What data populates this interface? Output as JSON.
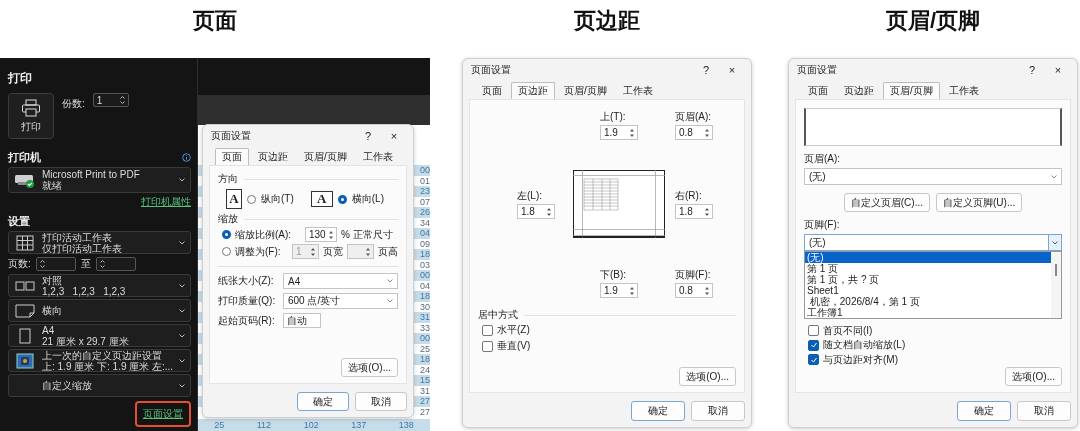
{
  "page_view": {
    "heading": "页面",
    "backstage": {
      "title": "打印",
      "print_button": "打印",
      "copies_label": "份数:",
      "copies_value": "1",
      "printer_heading": "打印机",
      "printer": {
        "name": "Microsoft Print to PDF",
        "status": "就绪"
      },
      "printer_properties": "打印机属性",
      "settings_heading": "设置",
      "settings": [
        {
          "kind": "print_area",
          "lines": [
            "打印活动工作表",
            "仅打印活动工作表"
          ]
        },
        {
          "kind": "page_range",
          "label": "页数:",
          "to": "至"
        },
        {
          "kind": "collation",
          "lines": [
            "对照",
            "1,2,3   1,2,3   1,2,3"
          ]
        },
        {
          "kind": "orientation",
          "lines": [
            "横向"
          ]
        },
        {
          "kind": "paper_size",
          "lines": [
            "A4",
            "21 厘米 x 29.7 厘米"
          ]
        },
        {
          "kind": "margins",
          "lines": [
            "上一次的自定义页边距设置",
            "上: 1.9 厘米 下: 1.9 厘米 左:..."
          ]
        },
        {
          "kind": "scaling",
          "lines": [
            "自定义缩放"
          ]
        }
      ],
      "page_setup_link": {
        "label": "页面设置",
        "highlighted": true
      }
    },
    "sheet_preview": {
      "cells": [
        {
          "text": "00",
          "highlighted": true
        },
        {
          "text": "01",
          "highlighted": false
        },
        {
          "text": "23",
          "highlighted": true
        },
        {
          "text": "07",
          "highlighted": false
        },
        {
          "text": "26",
          "highlighted": true
        },
        {
          "text": "34",
          "highlighted": false
        },
        {
          "text": "04",
          "highlighted": true
        },
        {
          "text": "09",
          "highlighted": false
        },
        {
          "text": "18",
          "highlighted": true
        },
        {
          "text": "03",
          "highlighted": false
        },
        {
          "text": "00",
          "highlighted": true
        },
        {
          "text": "04",
          "highlighted": false
        },
        {
          "text": "18",
          "highlighted": true
        },
        {
          "text": "30",
          "highlighted": false
        },
        {
          "text": "31",
          "highlighted": true
        },
        {
          "text": "33",
          "highlighted": false
        },
        {
          "text": "00",
          "highlighted": true
        },
        {
          "text": "25",
          "highlighted": false
        },
        {
          "text": "18",
          "highlighted": true
        },
        {
          "text": "24",
          "highlighted": false
        },
        {
          "text": "15",
          "highlighted": true
        },
        {
          "text": "31",
          "highlighted": false
        },
        {
          "text": "27",
          "highlighted": true
        },
        {
          "text": "27",
          "highlighted": false
        }
      ],
      "bottom_row": [
        "25",
        "112",
        "102",
        "137",
        "138"
      ]
    },
    "dialog": {
      "title": "页面设置",
      "help": "?",
      "close": "×",
      "tabs": [
        {
          "label": "页面",
          "selected": true
        },
        {
          "label": "页边距",
          "selected": false
        },
        {
          "label": "页眉/页脚",
          "selected": false
        },
        {
          "label": "工作表",
          "selected": false
        }
      ],
      "orientation": {
        "label": "方向",
        "options": [
          {
            "kind": "portrait",
            "glyph": "A",
            "label": "纵向(T)",
            "selected": false
          },
          {
            "kind": "landscape",
            "glyph": "A",
            "label": "横向(L)",
            "selected": true
          }
        ]
      },
      "scaling": {
        "label": "缩放",
        "adjust": {
          "label": "缩放比例(A):",
          "selected": true,
          "value": "130",
          "unit": "% 正常尺寸"
        },
        "fit": {
          "label": "调整为(F):",
          "selected": false,
          "disabled": true,
          "wide_value": "1",
          "wide_unit": "页宽",
          "tall_unit": "页高"
        }
      },
      "paper_size": {
        "label": "纸张大小(Z):",
        "value": "A4"
      },
      "print_quality": {
        "label": "打印质量(Q):",
        "value": "600 点/英寸"
      },
      "first_page_number": {
        "label": "起始页码(R):",
        "value": "自动"
      },
      "options_button": "选项(O)...",
      "ok_button": "确定",
      "cancel_button": "取消"
    }
  },
  "margins_view": {
    "heading": "页边距",
    "dialog": {
      "title": "页面设置",
      "help": "?",
      "close": "×",
      "tabs": [
        {
          "label": "页面",
          "selected": false
        },
        {
          "label": "页边距",
          "selected": true
        },
        {
          "label": "页眉/页脚",
          "selected": false
        },
        {
          "label": "工作表",
          "selected": false
        }
      ],
      "top": {
        "label": "上(T):",
        "value": "1.9"
      },
      "header": {
        "label": "页眉(A):",
        "value": "0.8"
      },
      "left": {
        "label": "左(L):",
        "value": "1.8"
      },
      "right": {
        "label": "右(R):",
        "value": "1.8"
      },
      "bottom": {
        "label": "下(B):",
        "value": "1.9"
      },
      "footer": {
        "label": "页脚(F):",
        "value": "0.8"
      },
      "center_on_page": {
        "label": "居中方式",
        "options": [
          {
            "label": "水平(Z)",
            "checked": false
          },
          {
            "label": "垂直(V)",
            "checked": false
          }
        ]
      },
      "options_button": "选项(O)...",
      "ok_button": "确定",
      "cancel_button": "取消"
    }
  },
  "header_footer_view": {
    "heading": "页眉/页脚",
    "dialog": {
      "title": "页面设置",
      "help": "?",
      "close": "×",
      "tabs": [
        {
          "label": "页面",
          "selected": false
        },
        {
          "label": "页边距",
          "selected": false
        },
        {
          "label": "页眉/页脚",
          "selected": true
        },
        {
          "label": "工作表",
          "selected": false
        }
      ],
      "header": {
        "label": "页眉(A):",
        "value": "(无)"
      },
      "custom_buttons": [
        "自定义页眉(C)...",
        "自定义页脚(U)..."
      ],
      "footer": {
        "label": "页脚(F):",
        "value": "(无)",
        "expanded": true,
        "options": [
          {
            "label": "(无)",
            "selected": true
          },
          {
            "label": "第 1 页",
            "selected": false
          },
          {
            "label": "第 1 页，共 ? 页",
            "selected": false
          },
          {
            "label": "Sheet1",
            "selected": false
          },
          {
            "label": " 机密，2026/8/4，第 1 页",
            "selected": false
          },
          {
            "label": "工作簿1",
            "selected": false
          }
        ]
      },
      "checkboxes": [
        {
          "label": "首页不同(I)",
          "checked": false
        },
        {
          "label": "随文档自动缩放(L)",
          "checked": true
        },
        {
          "label": "与页边距对齐(M)",
          "checked": true
        }
      ],
      "options_button": "选项(O)...",
      "ok_button": "确定",
      "cancel_button": "取消"
    }
  }
}
